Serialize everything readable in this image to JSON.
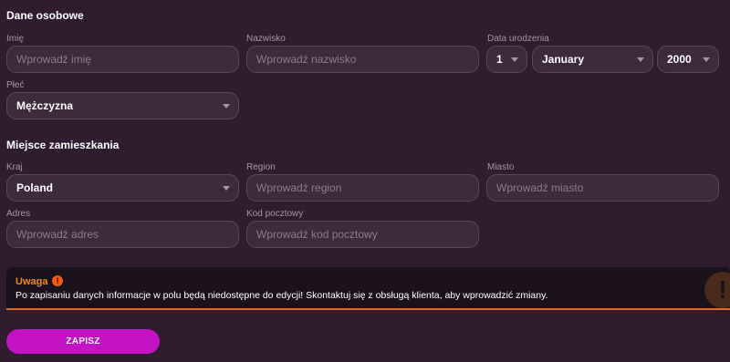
{
  "personal": {
    "title": "Dane osobowe",
    "first_name": {
      "label": "Imię",
      "placeholder": "Wprowadź imię"
    },
    "last_name": {
      "label": "Nazwisko",
      "placeholder": "Wprowadź nazwisko"
    },
    "birth_date": {
      "label": "Data urodzenia",
      "day": "1",
      "month": "January",
      "year": "2000"
    },
    "gender": {
      "label": "Płeć",
      "value": "Mężczyzna"
    }
  },
  "residence": {
    "title": "Miejsce zamieszkania",
    "country": {
      "label": "Kraj",
      "value": "Poland"
    },
    "region": {
      "label": "Region",
      "placeholder": "Wprowadź region"
    },
    "city": {
      "label": "Miasto",
      "placeholder": "Wprowadź miasto"
    },
    "address": {
      "label": "Adres",
      "placeholder": "Wprowadź adres"
    },
    "postal_code": {
      "label": "Kod pocztowy",
      "placeholder": "Wprowadź kod pocztowy"
    }
  },
  "warning": {
    "title": "Uwaga",
    "icon": "exclamation-icon",
    "text": "Po zapisaniu danych informacje w polu będą niedostępne do edycji! Skontaktuj się z obsługą klienta, aby wprowadzić zmiany."
  },
  "actions": {
    "save_label": "ZAPISZ"
  },
  "colors": {
    "background": "#2f1d2f",
    "field": "#3d2a3d",
    "accent": "#c413c4",
    "warning": "#f08a1a"
  }
}
